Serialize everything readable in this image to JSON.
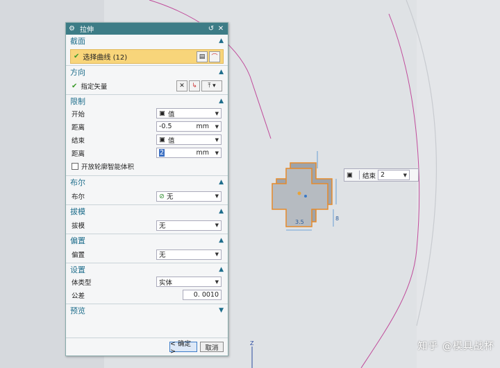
{
  "dialog": {
    "title": "拉伸",
    "sections": {
      "section": {
        "title": "截面",
        "curve_label": "选择曲线 (12)"
      },
      "direction": {
        "title": "方向",
        "vector_label": "指定矢量"
      },
      "limits": {
        "title": "限制",
        "start_label": "开始",
        "start_value": "值",
        "dist1_label": "距离",
        "dist1_value": "-0.5",
        "dist1_unit": "mm",
        "end_label": "结束",
        "end_value": "值",
        "dist2_label": "距离",
        "dist2_value": "2",
        "dist2_unit": "mm",
        "open_profile_label": "开放轮廓智能体积"
      },
      "boolean": {
        "title": "布尔",
        "label": "布尔",
        "value": "无"
      },
      "draft": {
        "title": "拔模",
        "label": "拔模",
        "value": "无"
      },
      "offset": {
        "title": "偏置",
        "label": "偏置",
        "value": "无"
      },
      "settings": {
        "title": "设置",
        "body_type_label": "体类型",
        "body_type_value": "实体",
        "tolerance_label": "公差",
        "tolerance_value": "0. 0010"
      },
      "preview": {
        "title": "预览"
      }
    },
    "ok_label": "< 确定 >",
    "cancel_label": "取消"
  },
  "floating": {
    "end_label": "结束",
    "end_value": "2"
  },
  "model": {
    "dim_bottom": "3.5",
    "dim_side": "8"
  },
  "axis_label": "Z",
  "watermark": "知乎 @模具战杯"
}
